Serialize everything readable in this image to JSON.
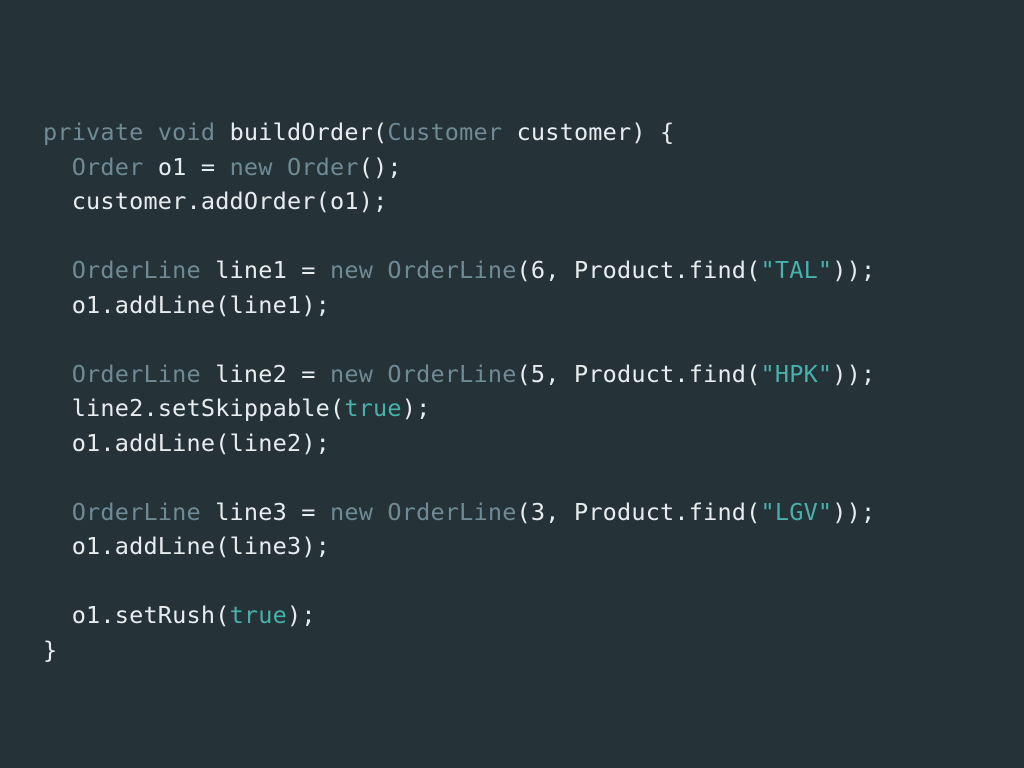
{
  "tokens": {
    "kw_private": "private",
    "kw_void": "void",
    "kw_new1": "new",
    "kw_new2": "new",
    "kw_new3": "new",
    "kw_new4": "new",
    "type_customer": "Customer",
    "type_order": "Order",
    "type_orderline1": "OrderLine",
    "type_orderline2": "OrderLine",
    "type_orderline3": "OrderLine",
    "type_orderline1b": "OrderLine",
    "type_orderline2b": "OrderLine",
    "type_orderline3b": "OrderLine",
    "lit_true1": "true",
    "lit_true2": "true",
    "str_tal": "\"TAL\"",
    "str_hpk": "\"HPK\"",
    "str_lgv": "\"LGV\"",
    "fn_name": "buildOrder",
    "param_name": "customer",
    "var_o1": "o1",
    "var_line1": "line1",
    "var_line2": "line2",
    "var_line3": "line3",
    "num_6": "6",
    "num_5": "5",
    "num_3": "3",
    "call_addOrder": "addOrder",
    "call_addLine": "addLine",
    "call_setSkippable": "setSkippable",
    "call_setRush": "setRush",
    "cls_Product": "Product",
    "call_find": "find"
  }
}
